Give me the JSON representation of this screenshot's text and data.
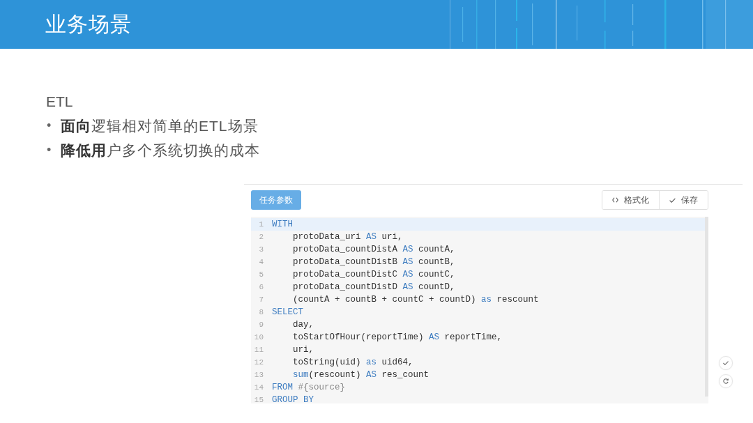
{
  "header": {
    "title": "业务场景"
  },
  "content": {
    "heading": "ETL",
    "bullets": [
      {
        "marker": "•",
        "text": "**面向**逻辑相对简单的ETL场景"
      },
      {
        "marker": "•",
        "text": "**降低用**户多个系统切换的成本"
      }
    ]
  },
  "editor": {
    "toolbar": {
      "params_button": "任务参数",
      "actions": [
        {
          "kind": "format",
          "label": "格式化"
        },
        {
          "kind": "save",
          "label": "保存"
        }
      ]
    },
    "lines": [
      {
        "number": "1",
        "highlighted": true,
        "indented": false,
        "tokens": [
          {
            "kind": "keyword",
            "text": "WITH"
          }
        ]
      },
      {
        "number": "2",
        "highlighted": false,
        "indented": true,
        "tokens": [
          {
            "kind": "plain",
            "text": "protoData_uri "
          },
          {
            "kind": "keyword",
            "text": "AS"
          },
          {
            "kind": "plain",
            "text": " uri,"
          }
        ]
      },
      {
        "number": "3",
        "highlighted": false,
        "indented": true,
        "tokens": [
          {
            "kind": "plain",
            "text": "protoData_countDistA "
          },
          {
            "kind": "keyword",
            "text": "AS"
          },
          {
            "kind": "plain",
            "text": " countA,"
          }
        ]
      },
      {
        "number": "4",
        "highlighted": false,
        "indented": true,
        "tokens": [
          {
            "kind": "plain",
            "text": "protoData_countDistB "
          },
          {
            "kind": "keyword",
            "text": "AS"
          },
          {
            "kind": "plain",
            "text": " countB,"
          }
        ]
      },
      {
        "number": "5",
        "highlighted": false,
        "indented": true,
        "tokens": [
          {
            "kind": "plain",
            "text": "protoData_countDistC "
          },
          {
            "kind": "keyword",
            "text": "AS"
          },
          {
            "kind": "plain",
            "text": " countC,"
          }
        ]
      },
      {
        "number": "6",
        "highlighted": false,
        "indented": true,
        "tokens": [
          {
            "kind": "plain",
            "text": "protoData_countDistD "
          },
          {
            "kind": "keyword",
            "text": "AS"
          },
          {
            "kind": "plain",
            "text": " countD,"
          }
        ]
      },
      {
        "number": "7",
        "highlighted": false,
        "indented": true,
        "tokens": [
          {
            "kind": "plain",
            "text": "(countA + countB + countC + countD) "
          },
          {
            "kind": "keyword",
            "text": "as"
          },
          {
            "kind": "plain",
            "text": " rescount"
          }
        ]
      },
      {
        "number": "8",
        "highlighted": false,
        "indented": false,
        "tokens": [
          {
            "kind": "keyword",
            "text": "SELECT"
          }
        ]
      },
      {
        "number": "9",
        "highlighted": false,
        "indented": true,
        "tokens": [
          {
            "kind": "plain",
            "text": "day,"
          }
        ]
      },
      {
        "number": "10",
        "highlighted": false,
        "indented": true,
        "tokens": [
          {
            "kind": "plain",
            "text": "toStartOfHour(reportTime) "
          },
          {
            "kind": "keyword",
            "text": "AS"
          },
          {
            "kind": "plain",
            "text": " reportTime,"
          }
        ]
      },
      {
        "number": "11",
        "highlighted": false,
        "indented": true,
        "tokens": [
          {
            "kind": "plain",
            "text": "uri,"
          }
        ]
      },
      {
        "number": "12",
        "highlighted": false,
        "indented": true,
        "tokens": [
          {
            "kind": "plain",
            "text": "toString(uid) "
          },
          {
            "kind": "keyword",
            "text": "as"
          },
          {
            "kind": "plain",
            "text": " uid64,"
          }
        ]
      },
      {
        "number": "13",
        "highlighted": false,
        "indented": true,
        "tokens": [
          {
            "kind": "keyword",
            "text": "sum"
          },
          {
            "kind": "plain",
            "text": "(rescount) "
          },
          {
            "kind": "keyword",
            "text": "AS"
          },
          {
            "kind": "plain",
            "text": " res_count"
          }
        ]
      },
      {
        "number": "14",
        "highlighted": false,
        "indented": false,
        "tokens": [
          {
            "kind": "keyword",
            "text": "FROM"
          },
          {
            "kind": "template",
            "text": " #{source}"
          }
        ]
      },
      {
        "number": "15",
        "highlighted": false,
        "indented": false,
        "tokens": [
          {
            "kind": "keyword",
            "text": "GROUP BY"
          }
        ]
      }
    ],
    "side_actions": [
      {
        "kind": "confirm"
      },
      {
        "kind": "refresh"
      }
    ]
  }
}
